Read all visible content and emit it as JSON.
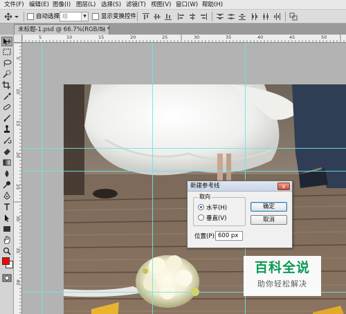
{
  "menubar": {
    "items": [
      "文件(F)",
      "编辑(E)",
      "图像(I)",
      "图层(L)",
      "选择(S)",
      "滤镜(T)",
      "视图(V)",
      "窗口(W)",
      "帮助(H)"
    ]
  },
  "options_bar": {
    "tool_icon": "move-tool-icon",
    "auto_select_label": "自动选择:",
    "auto_select_value": "组",
    "show_transform_label": "显示变换控件",
    "auto_select_checked": false,
    "show_transform_checked": false
  },
  "document_tab": {
    "title": "未标题-1.psd @ 66.7%(RGB/8) *",
    "close": "×"
  },
  "rulers": {
    "h_ticks": [
      "5",
      "10",
      "15",
      "20",
      "25",
      "30",
      "35",
      "40",
      "45",
      "50"
    ],
    "v_ticks": [
      "5",
      "10",
      "15",
      "20",
      "25",
      "30",
      "35",
      "40"
    ]
  },
  "toolbox": {
    "tools": [
      "move-tool",
      "marquee-tool",
      "lasso-tool",
      "quick-selection-tool",
      "crop-tool",
      "eyedropper-tool",
      "healing-brush-tool",
      "brush-tool",
      "clone-stamp-tool",
      "history-brush-tool",
      "eraser-tool",
      "gradient-tool",
      "blur-tool",
      "dodge-tool",
      "pen-tool",
      "type-tool",
      "path-selection-tool",
      "shape-tool",
      "hand-tool",
      "zoom-tool"
    ],
    "foreground_color": "#ff0000",
    "background_color": "#ffffff"
  },
  "dialog": {
    "title": "新建参考线",
    "close": "x",
    "orientation_legend": "取向",
    "horizontal_label": "水平(H)",
    "vertical_label": "垂直(V)",
    "selected": "horizontal",
    "ok_label": "确定",
    "cancel_label": "取消",
    "position_label": "位置(P):",
    "position_value": "600 px"
  },
  "watermark": {
    "title": "百科全说",
    "subtitle": "助你轻松解决"
  }
}
